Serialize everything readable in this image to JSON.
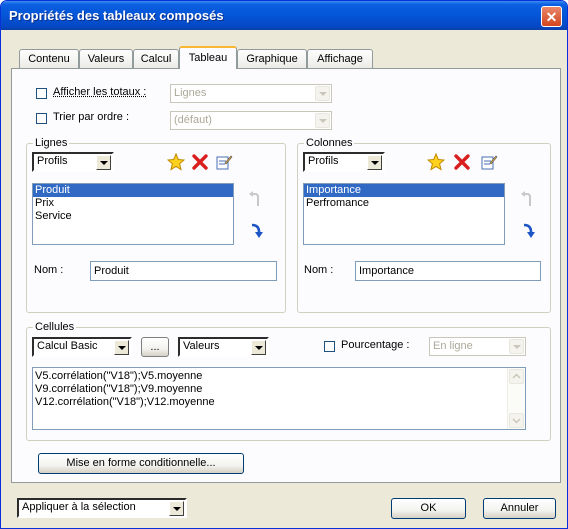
{
  "window": {
    "title": "Propriétés des tableaux composés"
  },
  "tabs": [
    {
      "label": "Contenu"
    },
    {
      "label": "Valeurs"
    },
    {
      "label": "Calcul"
    },
    {
      "label": "Tableau"
    },
    {
      "label": "Graphique"
    },
    {
      "label": "Affichage"
    }
  ],
  "options": {
    "show_totals_label": "Afficher les totaux :",
    "show_totals_value": "Lignes",
    "sort_label": "Trier par ordre :",
    "sort_value": "(défaut)"
  },
  "rows": {
    "group_label": "Lignes",
    "combo_value": "Profils",
    "items": [
      "Produit",
      "Prix",
      "Service"
    ],
    "name_label": "Nom :",
    "name_value": "Produit"
  },
  "columns": {
    "group_label": "Colonnes",
    "combo_value": "Profils",
    "items": [
      "Importance",
      "Perfromance"
    ],
    "name_label": "Nom :",
    "name_value": "Importance"
  },
  "cells": {
    "group_label": "Cellules",
    "calc_value": "Calcul Basic",
    "ellipsis_label": "...",
    "values_value": "Valeurs",
    "percent_label": "Pourcentage :",
    "percent_value": "En ligne",
    "lines": [
      "V5.corrélation(\"V18\");V5.moyenne",
      "V9.corrélation(\"V18\");V9.moyenne",
      "V12.corrélation(\"V18\");V12.moyenne"
    ]
  },
  "conditional_button": "Mise en forme conditionnelle...",
  "footer": {
    "apply_value": "Appliquer à la sélection",
    "ok_label": "OK",
    "cancel_label": "Annuler"
  }
}
